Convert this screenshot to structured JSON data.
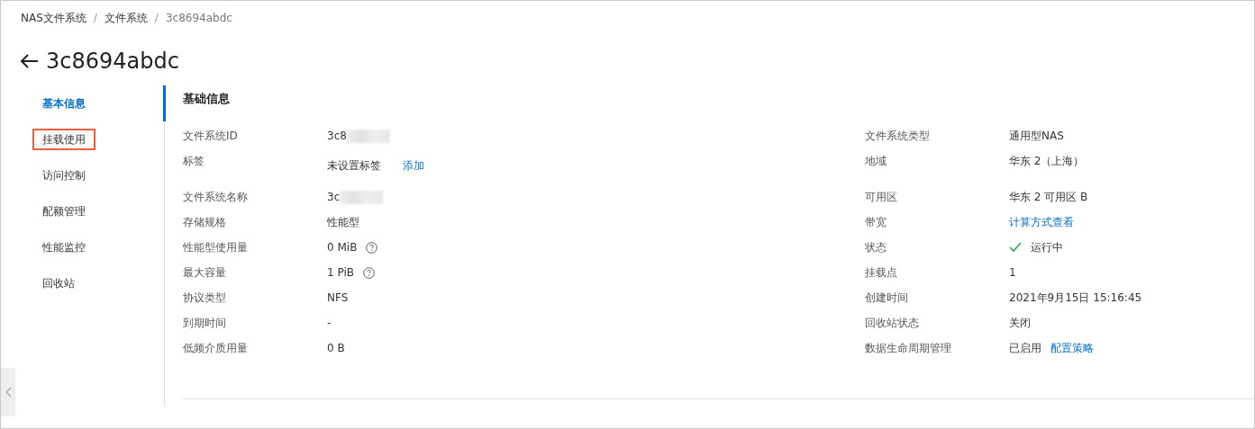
{
  "breadcrumb": [
    {
      "label": "NAS文件系统",
      "current": false
    },
    {
      "label": "文件系统",
      "current": false
    },
    {
      "label": "3c8694abdc",
      "current": true
    }
  ],
  "breadcrumb_separator": "/",
  "title": "3c8694abdc",
  "sidebar": [
    {
      "label": "基本信息",
      "selected": true,
      "highlighted": false
    },
    {
      "label": "挂载使用",
      "selected": false,
      "highlighted": true
    },
    {
      "label": "访问控制",
      "selected": false,
      "highlighted": false
    },
    {
      "label": "配额管理",
      "selected": false,
      "highlighted": false
    },
    {
      "label": "性能监控",
      "selected": false,
      "highlighted": false
    },
    {
      "label": "回收站",
      "selected": false,
      "highlighted": false
    }
  ],
  "section_title": "基础信息",
  "rows": [
    {
      "left": {
        "label": "文件系统ID",
        "value": "3c8",
        "blurred": true
      },
      "right": {
        "label": "文件系统类型",
        "value": "通用型NAS"
      }
    },
    {
      "tall": true,
      "left": {
        "label": "标签",
        "value": "未设置标签",
        "link": "添加"
      },
      "right": {
        "label": "地域",
        "value": "华东 2（上海）"
      }
    },
    {
      "left": {
        "label": "文件系统名称",
        "value": "3c",
        "blurred": true
      },
      "right": {
        "label": "可用区",
        "value": "华东 2 可用区 B"
      }
    },
    {
      "left": {
        "label": "存储规格",
        "value": "性能型"
      },
      "right": {
        "label": "带宽",
        "link": "计算方式查看"
      }
    },
    {
      "left": {
        "label": "性能型使用量",
        "value": "0 MiB",
        "help": true
      },
      "right": {
        "label": "状态",
        "value": "运行中",
        "status_ok": true
      }
    },
    {
      "left": {
        "label": "最大容量",
        "value": "1 PiB",
        "help": true
      },
      "right": {
        "label": "挂载点",
        "value": "1"
      }
    },
    {
      "left": {
        "label": "协议类型",
        "value": "NFS"
      },
      "right": {
        "label": "创建时间",
        "value": "2021年9月15日 15:16:45"
      }
    },
    {
      "left": {
        "label": "到期时间",
        "value": "-"
      },
      "right": {
        "label": "回收站状态",
        "value": "关闭"
      }
    },
    {
      "left": {
        "label": "低频介质用量",
        "value": "0 B"
      },
      "right": {
        "label": "数据生命周期管理",
        "value": "已启用",
        "link": "配置策略"
      }
    }
  ]
}
